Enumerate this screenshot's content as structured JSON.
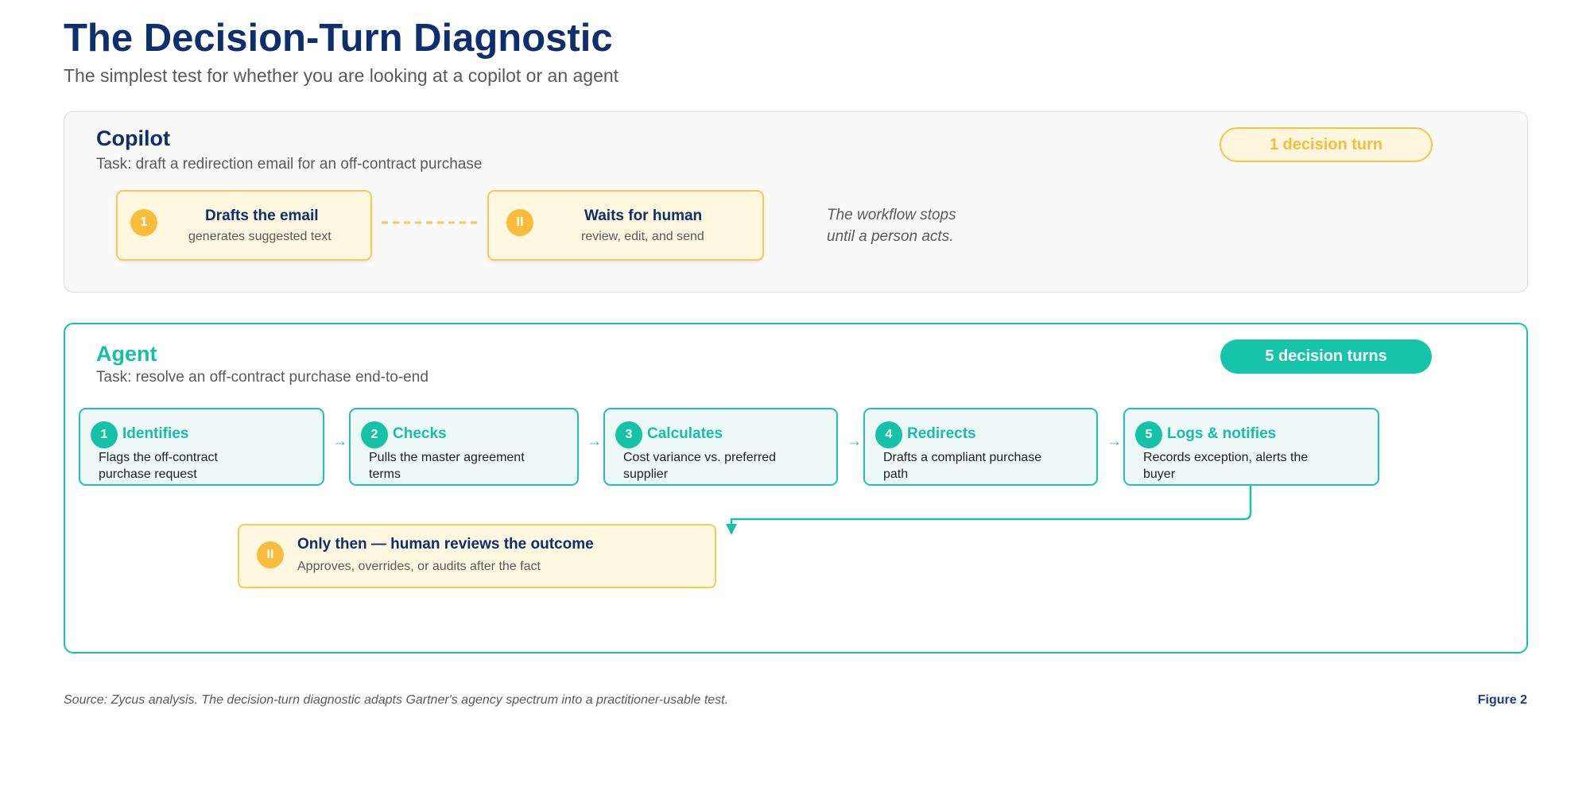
{
  "header": {
    "title": "The Decision-Turn Diagnostic",
    "subtitle": "The simplest test for whether you are looking at a copilot or an agent"
  },
  "copilot": {
    "title": "Copilot",
    "task": "Task: draft a redirection email for an off-contract purchase",
    "badge": "1 decision turn",
    "steps": [
      {
        "marker": "1",
        "title": "Drafts the email",
        "subtitle": "generates suggested text"
      },
      {
        "marker": "II",
        "title": "Waits for human",
        "subtitle": "review, edit, and send"
      }
    ],
    "note_line1": "The workflow stops",
    "note_line2": "until a person acts."
  },
  "agent": {
    "title": "Agent",
    "task": "Task: resolve an off-contract purchase end-to-end",
    "badge": "5 decision turns",
    "arrow_glyph": "→",
    "steps": [
      {
        "number": "1",
        "title": "Identifies",
        "desc": "Flags the off-contract purchase request"
      },
      {
        "number": "2",
        "title": "Checks",
        "desc": "Pulls the master agreement terms"
      },
      {
        "number": "3",
        "title": "Calculates",
        "desc": "Cost variance vs. preferred supplier"
      },
      {
        "number": "4",
        "title": "Redirects",
        "desc": "Drafts a compliant purchase path"
      },
      {
        "number": "5",
        "title": "Logs & notifies",
        "desc": "Records exception, alerts the buyer"
      }
    ],
    "human": {
      "marker": "II",
      "title": "Only then — human reviews the outcome",
      "subtitle": "Approves, overrides, or audits after the fact"
    }
  },
  "footer": {
    "source": "Source: Zycus analysis. The decision-turn diagnostic adapts Gartner's agency spectrum into a practitioner-usable test.",
    "figure": "Figure 2"
  },
  "colors": {
    "navy": "#0d2f6e",
    "teal": "#17c2aa",
    "amber": "#f9bd3d",
    "amber_fill": "#fff7df",
    "teal_fill": "#eef9f7"
  }
}
